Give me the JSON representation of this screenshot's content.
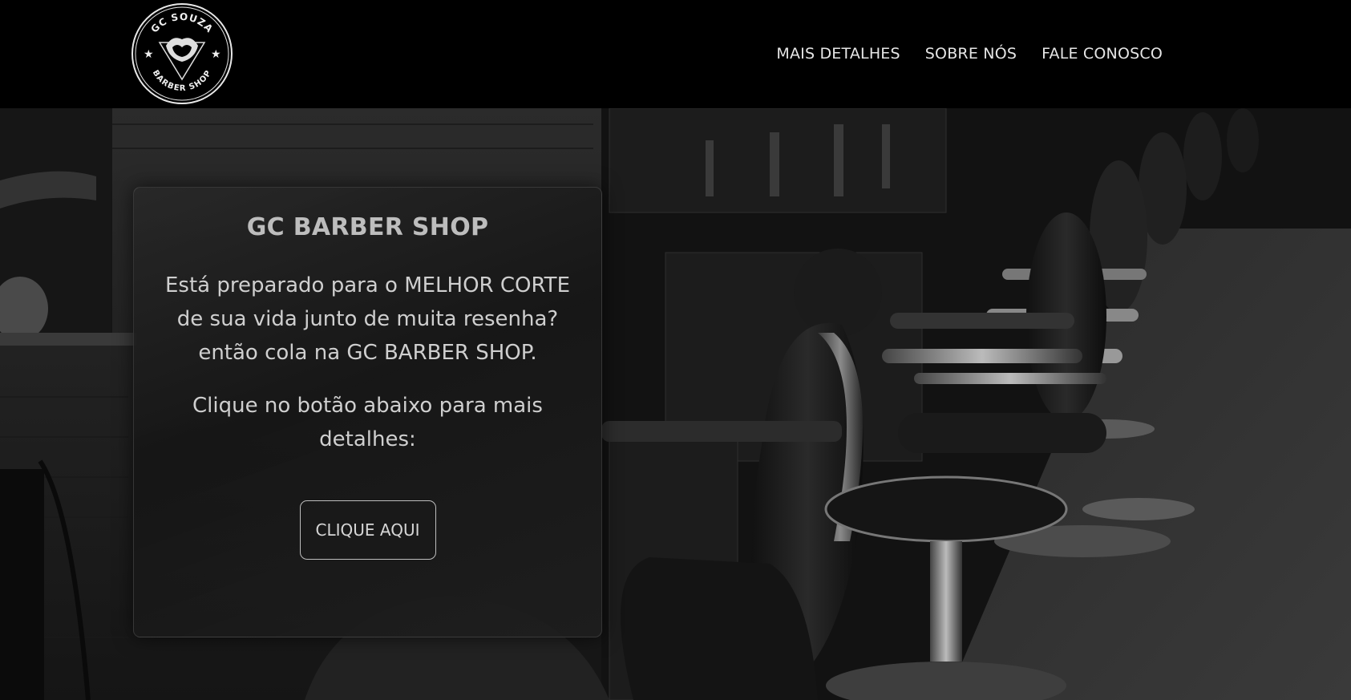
{
  "brand": {
    "logo_top_text": "GC SOUZA",
    "logo_bottom_text": "BARBER SHOP"
  },
  "nav": {
    "items": [
      {
        "label": "MAIS DETALHES"
      },
      {
        "label": "SOBRE NÓS"
      },
      {
        "label": "FALE CONOSCO"
      }
    ]
  },
  "hero": {
    "title": "GC BARBER SHOP",
    "paragraph1": "Está preparado para o MELHOR CORTE de sua vida junto de muita resenha? então cola na GC BARBER SHOP.",
    "paragraph2": "Clique no botão abaixo para mais detalhes:",
    "cta_label": "CLIQUE AQUI"
  },
  "colors": {
    "background": "#000000",
    "nav_text": "#e6e6e6",
    "card_title": "#bdbdbd",
    "card_text": "#cfcfcf"
  }
}
